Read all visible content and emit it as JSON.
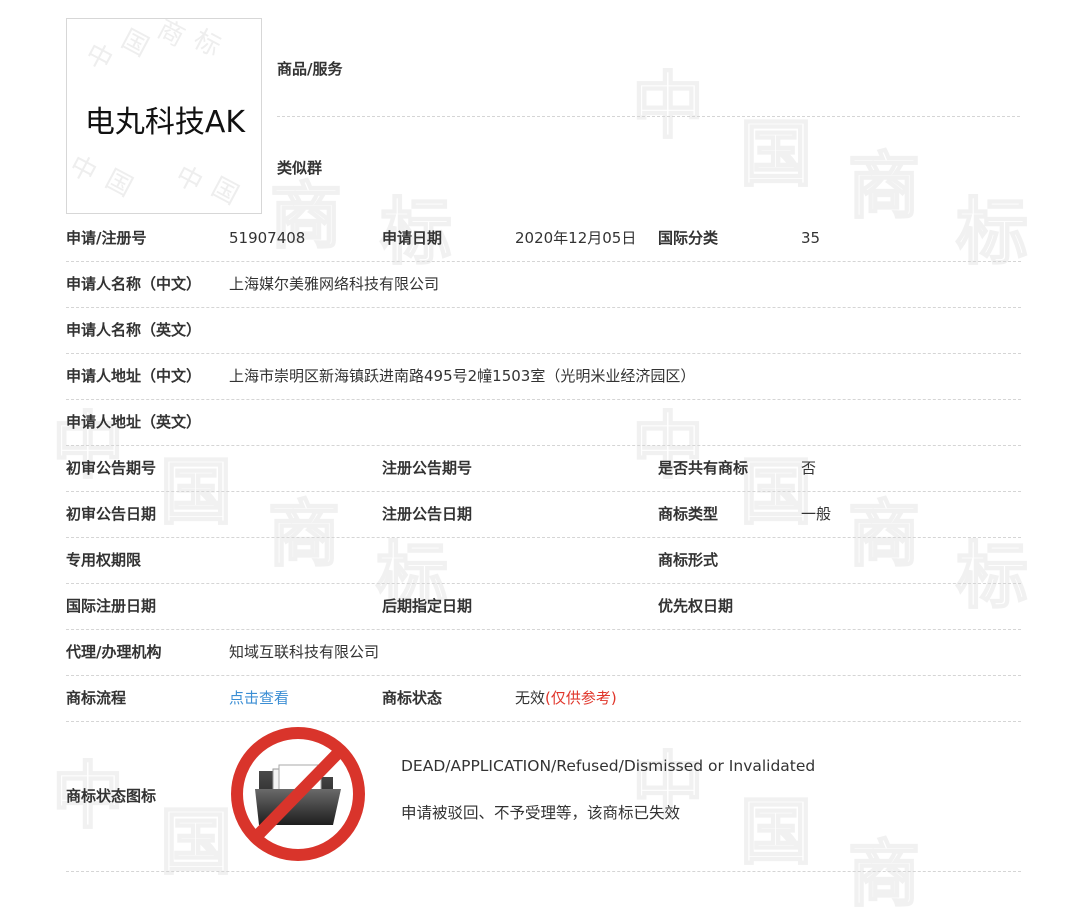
{
  "logo": {
    "text": "电丸科技AK",
    "watermark_chars": [
      "中",
      "国",
      "商",
      "标"
    ]
  },
  "watermark": {
    "chars": [
      "中",
      "国",
      "商",
      "标"
    ]
  },
  "top": {
    "goods_label": "商品/服务",
    "similar_label": "类似群"
  },
  "rows": {
    "reg_no": {
      "label": "申请/注册号",
      "value": "51907408"
    },
    "apply_date": {
      "label": "申请日期",
      "value": "2020年12月05日"
    },
    "intl_class": {
      "label": "国际分类",
      "value": "35"
    },
    "applicant_cn": {
      "label": "申请人名称（中文）",
      "value": "上海媒尔美雅网络科技有限公司"
    },
    "applicant_en": {
      "label": "申请人名称（英文）",
      "value": ""
    },
    "address_cn": {
      "label": "申请人地址（中文）",
      "value": "上海市崇明区新海镇跃进南路495号2幢1503室（光明米业经济园区）"
    },
    "address_en": {
      "label": "申请人地址（英文）",
      "value": ""
    },
    "prelim_issue": {
      "label": "初审公告期号",
      "value": ""
    },
    "reg_issue": {
      "label": "注册公告期号",
      "value": ""
    },
    "shared": {
      "label": "是否共有商标",
      "value": "否"
    },
    "prelim_date": {
      "label": "初审公告日期",
      "value": ""
    },
    "reg_date": {
      "label": "注册公告日期",
      "value": ""
    },
    "tm_type": {
      "label": "商标类型",
      "value": "一般"
    },
    "exclusive_period": {
      "label": "专用权期限",
      "value": ""
    },
    "tm_form": {
      "label": "商标形式",
      "value": ""
    },
    "intl_reg_date": {
      "label": "国际注册日期",
      "value": ""
    },
    "later_date": {
      "label": "后期指定日期",
      "value": ""
    },
    "priority_date": {
      "label": "优先权日期",
      "value": ""
    },
    "agent": {
      "label": "代理/办理机构",
      "value": "知域互联科技有限公司"
    },
    "flow": {
      "label": "商标流程",
      "link": "点击查看"
    },
    "status": {
      "label": "商标状态",
      "value": "无效",
      "note": "(仅供参考)"
    }
  },
  "status_icon": {
    "label": "商标状态图标",
    "en": "DEAD/APPLICATION/Refused/Dismissed or Invalidated",
    "zh": "申请被驳回、不予受理等，该商标已失效",
    "icon": "folder-prohibited-icon",
    "ring_color": "#d9342b"
  },
  "colors": {
    "link": "#3b8ed4",
    "status_red": "#e0362b",
    "divider": "#d5d5d5"
  }
}
